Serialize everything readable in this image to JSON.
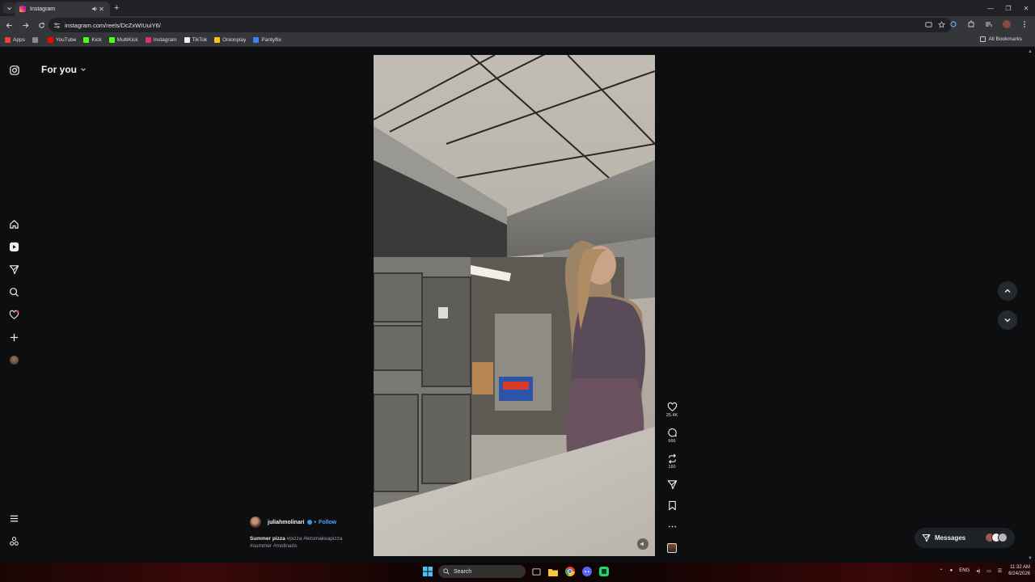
{
  "browser": {
    "tab_title": "Instagram",
    "url": "instagram.com/reels/DcZxWIUuiY6/",
    "bookmarks": [
      {
        "label": "Apps",
        "color": "#ea4335"
      },
      {
        "label": "YouTube",
        "color": "#ff0000"
      },
      {
        "label": "Kick",
        "color": "#53fc18"
      },
      {
        "label": "MultiKick",
        "color": "#53fc18"
      },
      {
        "label": "Instagram",
        "color": "#e1306c"
      },
      {
        "label": "TikTok",
        "color": "#111111"
      },
      {
        "label": "Onionplay",
        "color": "#f5c518"
      },
      {
        "label": "Pantyflix",
        "color": "#3b82f6"
      }
    ],
    "all_bookmarks": "All Bookmarks"
  },
  "instagram": {
    "feed_label": "For you",
    "reel": {
      "username": "juliahmolinari",
      "follow_label": "Follow",
      "caption_title": "Summer pizza",
      "hashtags_line1": "#pizza #letsmakeapizza",
      "hashtags_line2": "#summer #molinaris",
      "likes": "25.4K",
      "comments": "666",
      "reposts": "160"
    },
    "messages_label": "Messages",
    "accent_color": "#3897f0"
  },
  "taskbar": {
    "search_label": "Search",
    "lang": "ENG",
    "time": "11:32 AM",
    "date": "6/24/2026"
  }
}
